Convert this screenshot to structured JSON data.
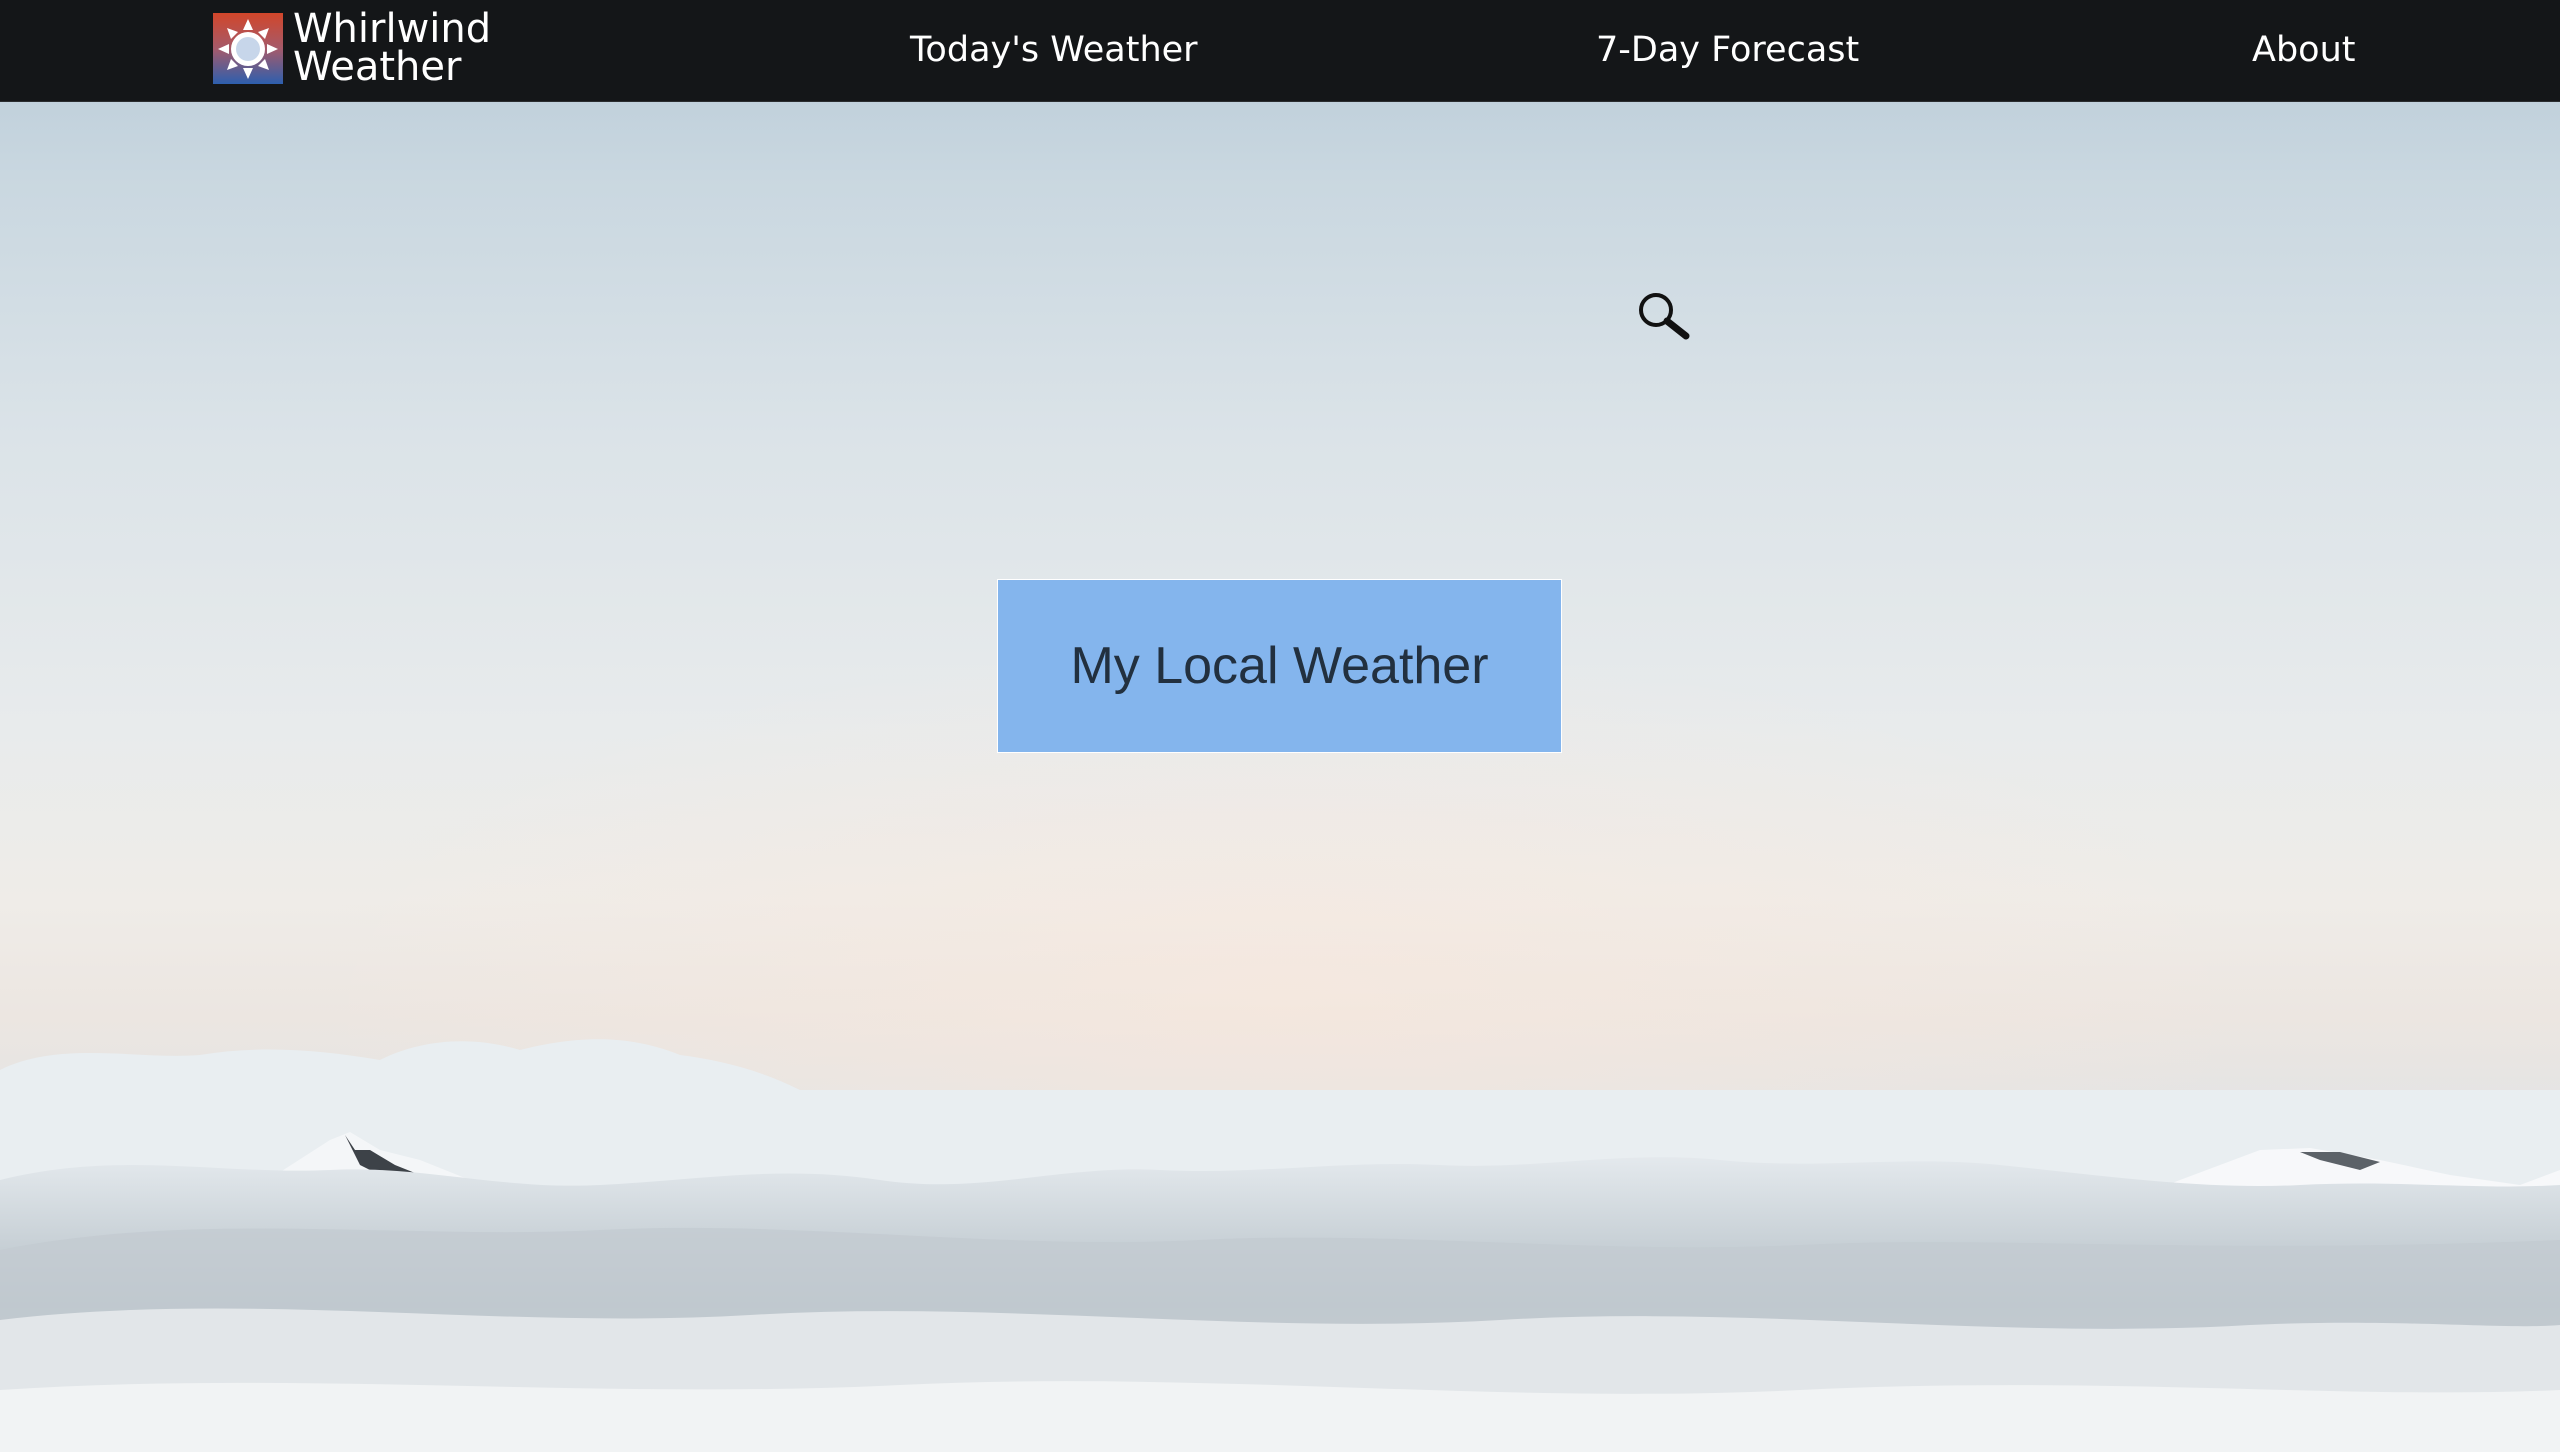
{
  "brand": {
    "logo_icon": "sun-logo-icon",
    "name_line1": "Whirlwind",
    "name_line2": "Weather"
  },
  "nav": {
    "items": [
      {
        "label": "Today's Weather"
      },
      {
        "label": "7-Day Forecast"
      },
      {
        "label": "About"
      }
    ]
  },
  "search": {
    "icon": "search-icon"
  },
  "hero": {
    "button_label": "My Local Weather"
  },
  "colors": {
    "navbar_bg": "#141618",
    "button_bg": "#84b5ed",
    "button_text": "#22303f",
    "logo_top": "#c8472a",
    "logo_bottom": "#2f5ea8"
  }
}
